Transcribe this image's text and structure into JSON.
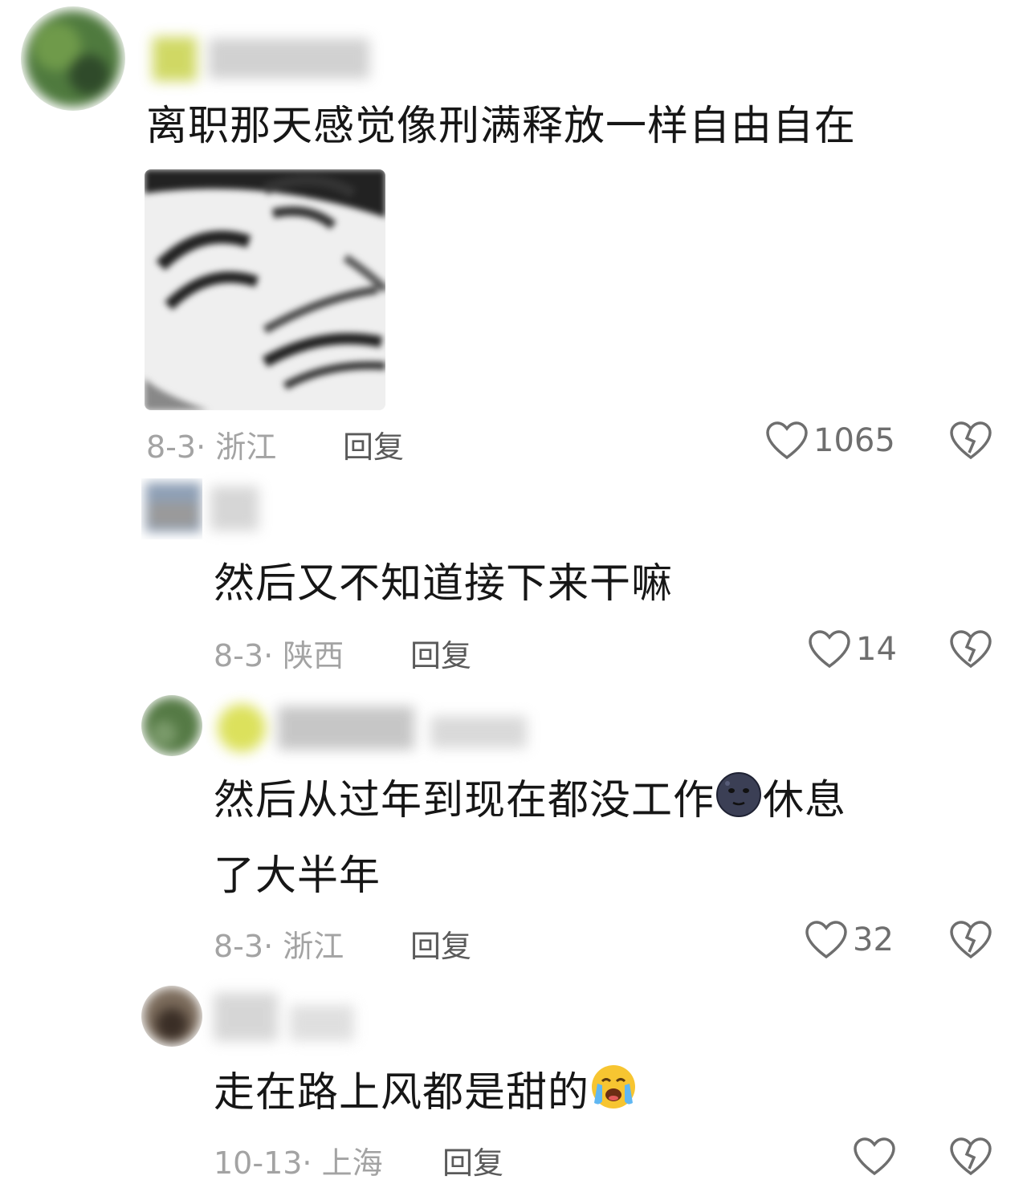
{
  "comments": [
    {
      "text": "离职那天感觉像刑满释放一样自由自在",
      "has_sticker": true,
      "sticker_icon": "laughing-face-meme-sticker",
      "date": "8-3",
      "sep": "·",
      "location": "浙江",
      "reply_label": "回复",
      "likes": "1065"
    },
    {
      "text": "然后又不知道接下来干嘛",
      "date": "8-3",
      "sep": "·",
      "location": "陕西",
      "reply_label": "回复",
      "likes": "14"
    },
    {
      "text_line1": "然后从过年到现在都没工作",
      "emoji1": "new-moon-face-emoji",
      "text_line1_after": "休息",
      "text_line2": "了大半年",
      "date": "8-3",
      "sep": "·",
      "location": "浙江",
      "reply_label": "回复",
      "likes": "32"
    },
    {
      "text": "走在路上风都是甜的",
      "emoji": "loudly-crying-face-emoji",
      "date": "10-13",
      "sep": "·",
      "location": "上海",
      "reply_label": "回复",
      "likes": ""
    }
  ],
  "colors": {
    "text": "#161616",
    "meta": "#a3a3a3",
    "reply": "#5a5a5a",
    "icon": "#6e6e6e"
  }
}
